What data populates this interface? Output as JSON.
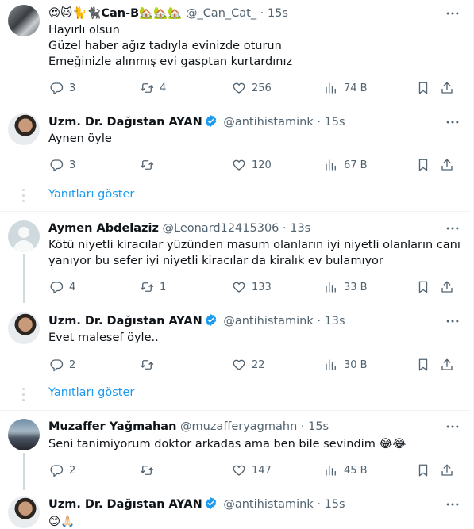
{
  "tweets": [
    {
      "display_name": "😍🐱🐈🐈‍⬛Can-B🏡🏡🏡",
      "handle": "@_Can_Cat_",
      "dot": "·",
      "time": "15s",
      "lines": [
        "Hayırlı olsun",
        "Güzel haber ağız tadıyla evinizde oturun",
        "Emeğinizle alınmış evi gasptan kurtardınız"
      ],
      "replies": "3",
      "retweets": "4",
      "likes": "256",
      "views": "74 B"
    },
    {
      "display_name": "Uzm. Dr. Dağıstan AYAN",
      "handle": "@antihistamink",
      "dot": "·",
      "time": "15s",
      "lines": [
        "Aynen öyle"
      ],
      "replies": "3",
      "retweets": "",
      "likes": "120",
      "views": "67 B"
    },
    {
      "display_name": "Aymen Abdelaziz",
      "handle": "@Leonard12415306",
      "dot": "·",
      "time": "13s",
      "lines": [
        "Kötü niyetli kiracılar yüzünden masum olanların iyi niyetli olanların canı",
        "yanıyor bu sefer iyi niyetli kiracılar da kiralık ev bulamıyor"
      ],
      "replies": "4",
      "retweets": "1",
      "likes": "133",
      "views": "33 B"
    },
    {
      "display_name": "Uzm. Dr. Dağıstan AYAN",
      "handle": "@antihistamink",
      "dot": "·",
      "time": "13s",
      "lines": [
        "Evet malesef öyle.."
      ],
      "replies": "2",
      "retweets": "",
      "likes": "22",
      "views": "30 B"
    },
    {
      "display_name": "Muzaffer Yağmahan",
      "handle": "@muzafferyagmahn",
      "dot": "·",
      "time": "15s",
      "lines": [
        "Seni tanimiyorum doktor arkadas ama ben bile sevindim 😂😂"
      ],
      "replies": "2",
      "retweets": "",
      "likes": "147",
      "views": "45 B"
    },
    {
      "display_name": "Uzm. Dr. Dağıstan AYAN",
      "handle": "@antihistamink",
      "dot": "·",
      "time": "15s",
      "lines": [
        "😊🙏🏻"
      ],
      "replies": "",
      "retweets": "",
      "likes": "",
      "views": ""
    }
  ],
  "show_replies_label": "Yanıtları göster",
  "colors": {
    "accent": "#1d9bf0",
    "muted": "#536471",
    "text": "#0f1419",
    "divider": "#eff3f4"
  },
  "icons": [
    "more-icon",
    "reply-icon",
    "retweet-icon",
    "like-icon",
    "views-icon",
    "bookmark-icon",
    "share-icon",
    "verified-badge-icon"
  ]
}
